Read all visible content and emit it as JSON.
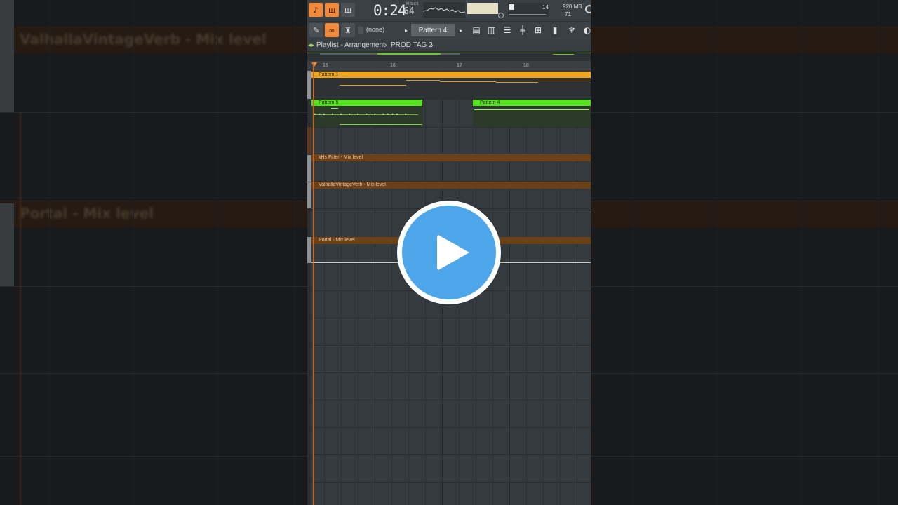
{
  "background": {
    "ghost_labels": [
      "ValhallaVintageVerb - Mix level",
      "Portal - Mix level"
    ]
  },
  "toolbar": {
    "time": "0:24",
    "time_sub": "64",
    "time_unit": "M:S:CS",
    "cpu": "14",
    "memory": "920 MB",
    "polyphony": "71",
    "pattern_selector": "(none)",
    "current_pattern": "Pattern 4"
  },
  "breadcrumb": {
    "title": "Playlist - Arrangement",
    "separator": "›",
    "current": "PROD TAG 2",
    "chevron": "›"
  },
  "ruler": {
    "bars": [
      "15",
      "16",
      "17",
      "18"
    ]
  },
  "clips": [
    {
      "label": "Pattern 1",
      "color": "#f0a522"
    },
    {
      "label": "Pattern 5",
      "color": "#56e022"
    },
    {
      "label": "Pattern 4",
      "color": "#56e022"
    }
  ],
  "automation_lanes": [
    {
      "label": "kHs Filter - Mix level"
    },
    {
      "label": "ValhallaVintageVerb - Mix level"
    },
    {
      "label": "Portal - Mix level"
    }
  ],
  "colors": {
    "accent_orange": "#f08a3a",
    "play_button": "#4ea6ea"
  },
  "icons": {
    "play": "play-icon"
  }
}
